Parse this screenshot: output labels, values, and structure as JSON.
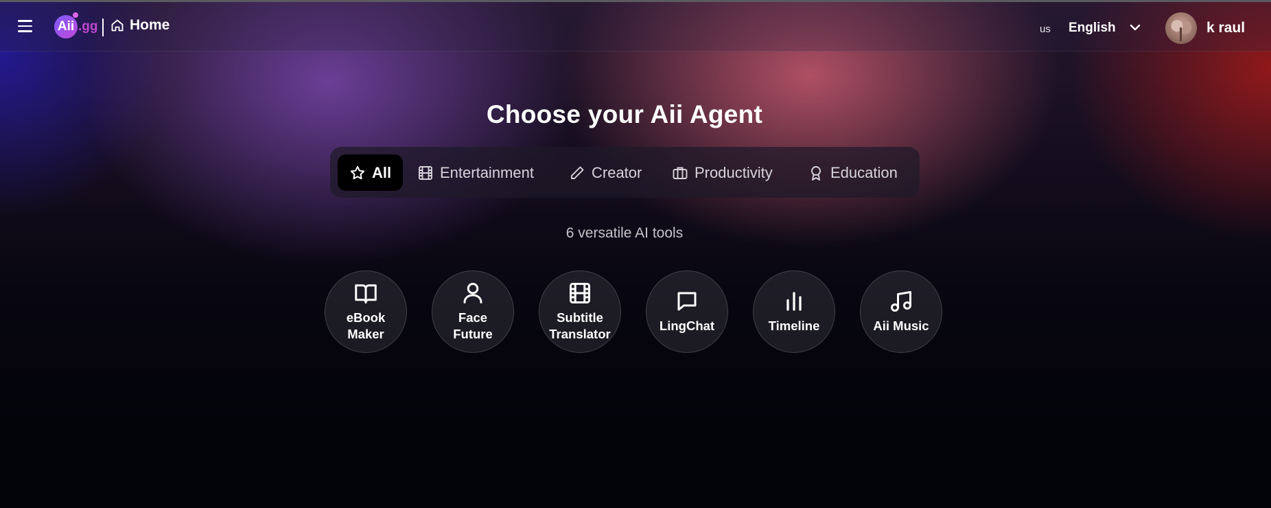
{
  "header": {
    "logo_text": "Aii",
    "logo_suffix": ".gg",
    "home_label": "Home",
    "language_code": "us",
    "language": "English",
    "user_name": "k raul"
  },
  "main": {
    "title": "Choose your Aii Agent",
    "subtitle": "6 versatile AI tools",
    "tabs": [
      {
        "label": "All",
        "icon": "star-icon",
        "active": true
      },
      {
        "label": "Entertainment",
        "icon": "film-icon",
        "active": false
      },
      {
        "label": "Creator",
        "icon": "pencil-icon",
        "active": false
      },
      {
        "label": "Productivity",
        "icon": "briefcase-icon",
        "active": false
      },
      {
        "label": "Education",
        "icon": "award-icon",
        "active": false
      }
    ],
    "tools": [
      {
        "label": "eBook Maker",
        "icon": "book-icon"
      },
      {
        "label": "Face Future",
        "icon": "user-icon"
      },
      {
        "label": "Subtitle Translator",
        "icon": "film-icon"
      },
      {
        "label": "LingChat",
        "icon": "chat-icon"
      },
      {
        "label": "Timeline",
        "icon": "bar-chart-icon"
      },
      {
        "label": "Aii Music",
        "icon": "music-icon"
      }
    ]
  },
  "colors": {
    "accent_logo": "#c148d0",
    "active_tab_bg": "#000000",
    "page_bg": "#03030a"
  }
}
